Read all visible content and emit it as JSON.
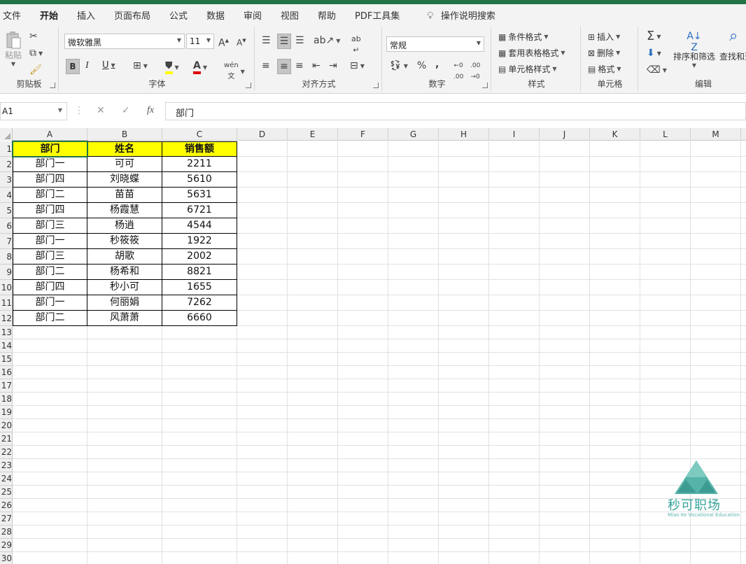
{
  "menu_tabs": [
    {
      "label": "文件",
      "active": false
    },
    {
      "label": "开始",
      "active": true
    },
    {
      "label": "插入",
      "active": false
    },
    {
      "label": "页面布局",
      "active": false
    },
    {
      "label": "公式",
      "active": false
    },
    {
      "label": "数据",
      "active": false
    },
    {
      "label": "审阅",
      "active": false
    },
    {
      "label": "视图",
      "active": false
    },
    {
      "label": "帮助",
      "active": false
    },
    {
      "label": "PDF工具集",
      "active": false
    }
  ],
  "tell_me": "操作说明搜索",
  "ribbon": {
    "clipboard": {
      "label": "剪贴板",
      "paste": "粘贴"
    },
    "font": {
      "label": "字体",
      "name": "微软雅黑",
      "size": "11",
      "bold": "B",
      "italic": "I",
      "underline": "U"
    },
    "alignment": {
      "label": "对齐方式"
    },
    "number": {
      "label": "数字",
      "format": "常规"
    },
    "styles": {
      "label": "样式",
      "conditional": "条件格式",
      "table": "套用表格格式",
      "cell_styles": "单元格样式"
    },
    "cells": {
      "label": "单元格",
      "insert": "插入",
      "delete": "删除",
      "format": "格式"
    },
    "editing": {
      "label": "编辑",
      "sort": "排序和筛选",
      "find": "查找和选"
    }
  },
  "formula_bar": {
    "name_box": "A1",
    "content": "部门"
  },
  "columns": [
    "A",
    "B",
    "C",
    "D",
    "E",
    "F",
    "G",
    "H",
    "I",
    "J",
    "K",
    "L",
    "M"
  ],
  "rows": [
    "1",
    "2",
    "3",
    "4",
    "5",
    "6",
    "7",
    "8",
    "9",
    "10",
    "11",
    "12",
    "13",
    "14",
    "15",
    "16",
    "17",
    "18",
    "19",
    "20",
    "21",
    "22",
    "23",
    "24",
    "25",
    "26",
    "27",
    "28",
    "29",
    "30"
  ],
  "table": {
    "headers": [
      "部门",
      "姓名",
      "销售额"
    ],
    "rows": [
      [
        "部门一",
        "可可",
        "2211"
      ],
      [
        "部门四",
        "刘晓蝶",
        "5610"
      ],
      [
        "部门二",
        "苗苗",
        "5631"
      ],
      [
        "部门四",
        "杨霞慧",
        "6721"
      ],
      [
        "部门三",
        "杨逍",
        "4544"
      ],
      [
        "部门一",
        "秒筱筱",
        "1922"
      ],
      [
        "部门三",
        "胡歌",
        "2002"
      ],
      [
        "部门二",
        "杨希和",
        "8821"
      ],
      [
        "部门四",
        "秒小可",
        "1655"
      ],
      [
        "部门一",
        "何丽娟",
        "7262"
      ],
      [
        "部门二",
        "风萧萧",
        "6660"
      ]
    ]
  },
  "watermark": {
    "name": "秒可职场",
    "sub": "Miao Ke Vocational Education"
  },
  "colors": {
    "accent": "#217346",
    "header_fill": "#ffff00",
    "watermark": "#34a39a"
  }
}
